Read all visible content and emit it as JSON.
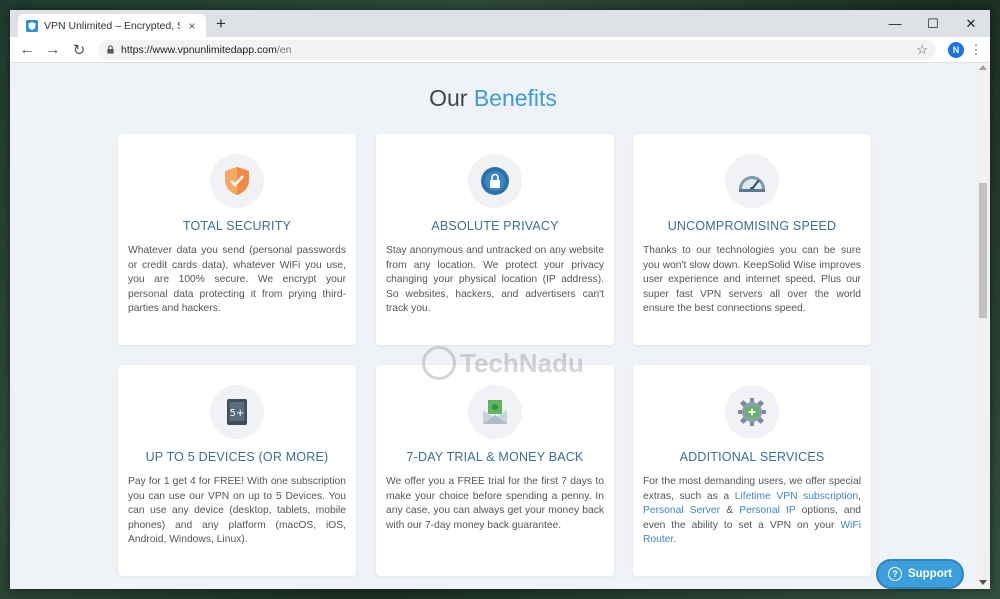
{
  "browser": {
    "tab_title": "VPN Unlimited – Encrypted, Secu",
    "tab_close": "×",
    "new_tab": "+",
    "url_host": "https://www.vpnunlimitedapp.com",
    "url_path": "/en",
    "avatar_letter": "N",
    "controls": {
      "minimize": "—",
      "maximize": "☐",
      "close": "✕"
    },
    "back": "←",
    "forward": "→",
    "reload": "↻",
    "star": "☆",
    "menu": "⋮"
  },
  "heading": {
    "prefix": "Our ",
    "accent": "Benefits"
  },
  "cards": [
    {
      "title": "TOTAL SECURITY",
      "text": "Whatever data you send (personal passwords or credit cards data), whatever WiFi you use, you are 100% secure. We encrypt your personal data protecting it from prying third-parties and hackers."
    },
    {
      "title": "ABSOLUTE PRIVACY",
      "text": "Stay anonymous and untracked on any website from any location. We protect your privacy changing your physical location (IP address). So websites, hackers, and advertisers can't track you."
    },
    {
      "title": "UNCOMPROMISING SPEED",
      "text": "Thanks to our technologies you can be sure you won't slow down. KeepSolid Wise improves user experience and internet speed. Plus our super fast VPN servers all over the world ensure the best connections speed."
    },
    {
      "title": "UP TO 5 DEVICES (OR MORE)",
      "text": "Pay for 1 get 4 for FREE! With one subscription you can use our VPN on up to 5 Devices. You can use any device (desktop, tablets, mobile phones) and any platform (macOS, iOS, Android, Windows, Linux)."
    },
    {
      "title": "7-DAY TRIAL & MONEY BACK",
      "text": "We offer you a FREE trial for the first 7 days to make your choice before spending a penny. In any case, you can always get your money back with our 7-day money back guarantee."
    },
    {
      "title": "ADDITIONAL SERVICES",
      "text_1": "For the most demanding users, we offer special extras, such as a ",
      "link_1": "Lifetime VPN subscription",
      "text_2": ", ",
      "link_2": "Personal Server",
      "text_3": " & ",
      "link_3": "Personal IP",
      "text_4": " options, and even the ability to set a VPN on your ",
      "link_4": "WiFi Router",
      "text_5": "."
    }
  ],
  "device_badge": "5+",
  "watermark": "TechNadu",
  "support": {
    "label": "Support",
    "icon": "?"
  },
  "colors": {
    "accent": "#3d9bd6",
    "title": "#3a6f96",
    "support": "#3a9fdc"
  }
}
